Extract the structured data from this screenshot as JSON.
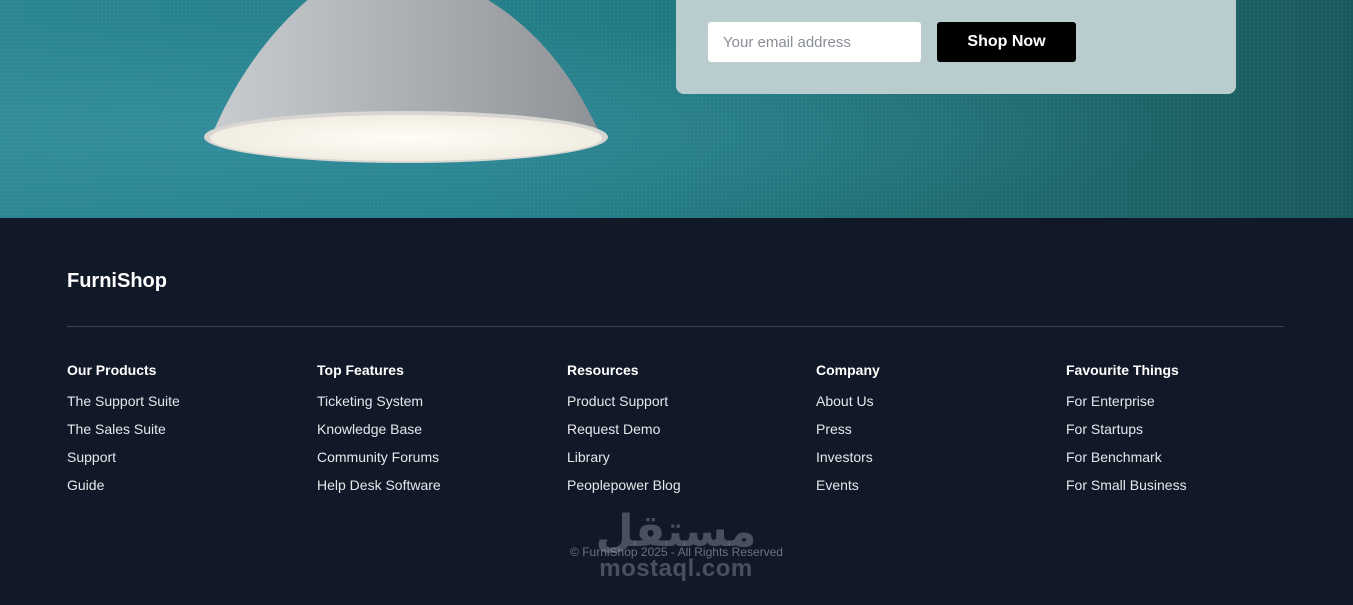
{
  "hero": {
    "lamp_image": "pendant-lamp-image",
    "newsletter": {
      "email_placeholder": "Your email address",
      "email_value": "",
      "button_label": "Shop Now"
    }
  },
  "footer": {
    "brand": "FurniShop",
    "columns": [
      {
        "title": "Our Products",
        "links": [
          "The Support Suite",
          "The Sales Suite",
          "Support",
          "Guide"
        ]
      },
      {
        "title": "Top Features",
        "links": [
          "Ticketing System",
          "Knowledge Base",
          "Community Forums",
          "Help Desk Software"
        ]
      },
      {
        "title": "Resources",
        "links": [
          "Product Support",
          "Request Demo",
          "Library",
          "Peoplepower Blog"
        ]
      },
      {
        "title": "Company",
        "links": [
          "About Us",
          "Press",
          "Investors",
          "Events"
        ]
      },
      {
        "title": "Favourite Things",
        "links": [
          "For Enterprise",
          "For Startups",
          "For Benchmark",
          "For Small Business"
        ]
      }
    ],
    "copyright": "© FurniShop 2025 - All Rights Reserved"
  },
  "watermark": {
    "arabic": "مستقل",
    "latin": "mostaql.com"
  },
  "colors": {
    "footer_bg": "#111827",
    "hero_teal": "#24808b",
    "button_bg": "#000000",
    "panel_bg": "#b9cdcf"
  }
}
